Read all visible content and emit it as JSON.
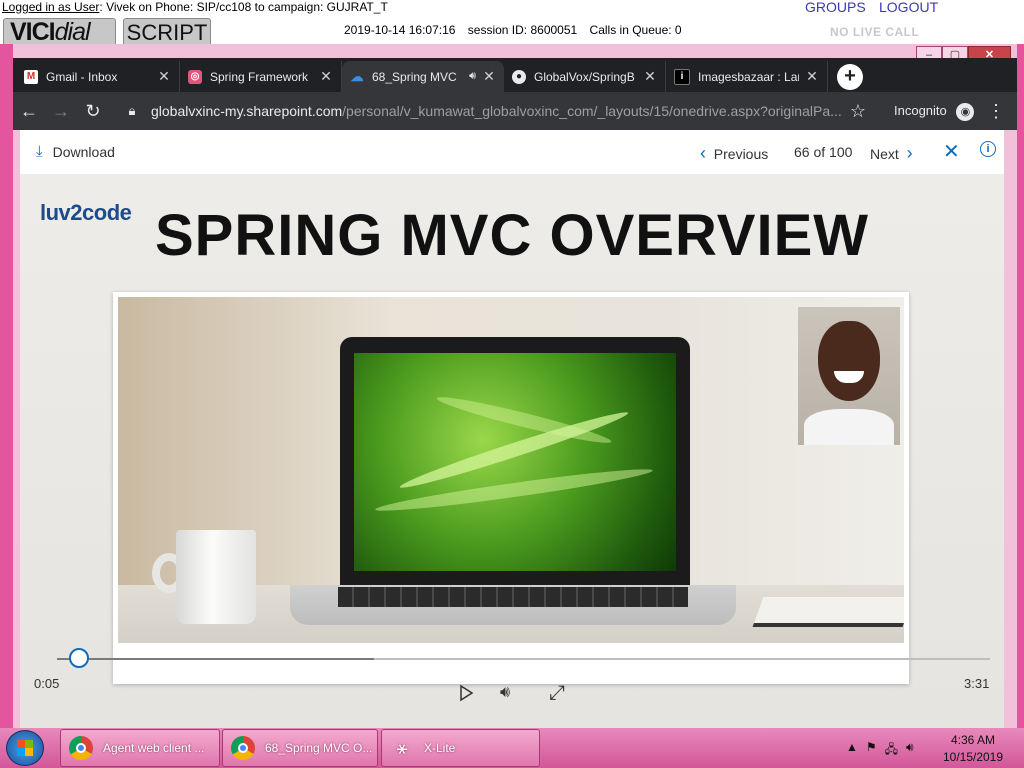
{
  "vicidial": {
    "logged_in_label": "Logged in as User",
    "login_info": ": Vivek on Phone: SIP/cc108  to campaign: GUJRAT_T",
    "logo_bold": "VICI",
    "logo_italic": "dial",
    "script_tab": "SCRIPT",
    "datetime": "2019-10-14 16:07:16",
    "session": "session ID: 8600051",
    "calls_queue": "Calls in Queue: 0",
    "groups_link": "GROUPS",
    "logout_link": "LOGOUT",
    "no_live_call": "NO LIVE CALL"
  },
  "window_controls": {
    "minimize": "–",
    "maximize": "▢",
    "close": "✕"
  },
  "browser": {
    "tabs": [
      {
        "title": "Gmail - Inbox",
        "icon": "gmail-icon",
        "active": false
      },
      {
        "title": "Spring Framework",
        "icon": "spring-icon",
        "active": false
      },
      {
        "title": "68_Spring MVC",
        "icon": "onedrive-icon",
        "active": true
      },
      {
        "title": "GlobalVox/SpringB",
        "icon": "github-icon",
        "active": false
      },
      {
        "title": "Imagesbazaar : Lar",
        "icon": "imagesbazaar-icon",
        "active": false
      }
    ],
    "new_tab": "+",
    "url_domain": "globalvxinc-my.sharepoint.com",
    "url_path": "/personal/v_kumawat_globalvoxinc_com/_layouts/15/onedrive.aspx?originalPa...",
    "mode": "Incognito"
  },
  "viewer": {
    "download_label": "Download",
    "previous_label": "Previous",
    "counter": "66 of 100",
    "next_label": "Next"
  },
  "video": {
    "brand": "luv2code",
    "title": "SPRING MVC OVERVIEW",
    "current_time": "0:05",
    "total_time": "3:31",
    "progress_fraction": 0.024,
    "buffered_fraction": 0.34
  },
  "taskbar": {
    "items": [
      {
        "label": "Agent web client ...",
        "icon": "chrome-icon"
      },
      {
        "label": "68_Spring MVC O...",
        "icon": "chrome-icon"
      },
      {
        "label": "X-Lite",
        "icon": "xlite-icon"
      }
    ],
    "time": "4:36 AM",
    "date": "10/15/2019"
  },
  "colors": {
    "accent": "#0f6cbd",
    "taskbar": "#e077ad",
    "chrome_dark": "#202124",
    "link": "#3a3ab0"
  }
}
